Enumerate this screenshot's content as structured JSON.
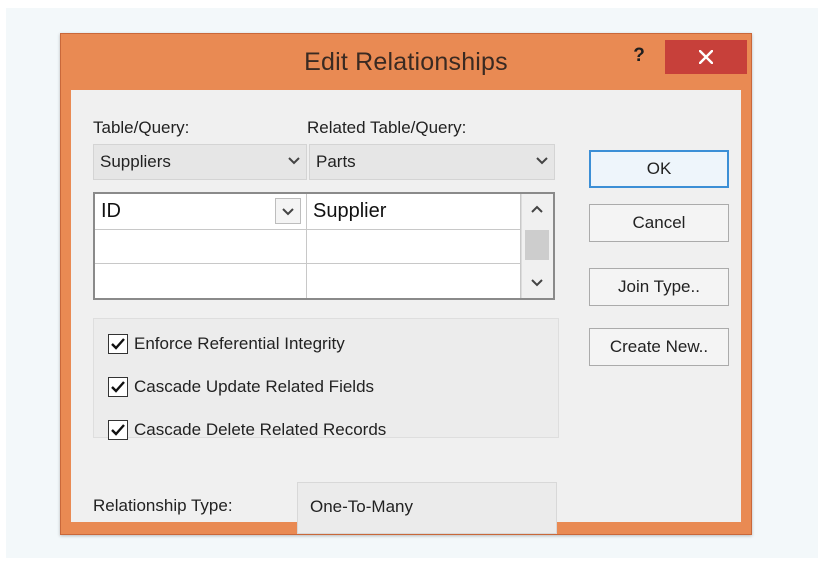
{
  "window": {
    "title": "Edit Relationships",
    "help_label": "?",
    "close_icon": "close-icon"
  },
  "table_query": {
    "label": "Table/Query:",
    "selected": "Suppliers"
  },
  "related_table_query": {
    "label": "Related Table/Query:",
    "selected": "Parts"
  },
  "fields_grid": {
    "rows": [
      {
        "left": "ID",
        "right": "Supplier"
      },
      {
        "left": "",
        "right": ""
      },
      {
        "left": "",
        "right": ""
      }
    ]
  },
  "options": {
    "enforce": {
      "label": "Enforce Referential Integrity",
      "checked": true
    },
    "cascade_update": {
      "label": "Cascade Update Related Fields",
      "checked": true
    },
    "cascade_delete": {
      "label": "Cascade Delete Related Records",
      "checked": true
    }
  },
  "relationship_type": {
    "label": "Relationship Type:",
    "value": "One-To-Many"
  },
  "buttons": {
    "ok": "OK",
    "cancel": "Cancel",
    "join_type": "Join Type..",
    "create_new": "Create New.."
  },
  "colors": {
    "frame": "#e98a53",
    "close_button": "#c7403a",
    "default_button_border": "#3c8fd6"
  }
}
